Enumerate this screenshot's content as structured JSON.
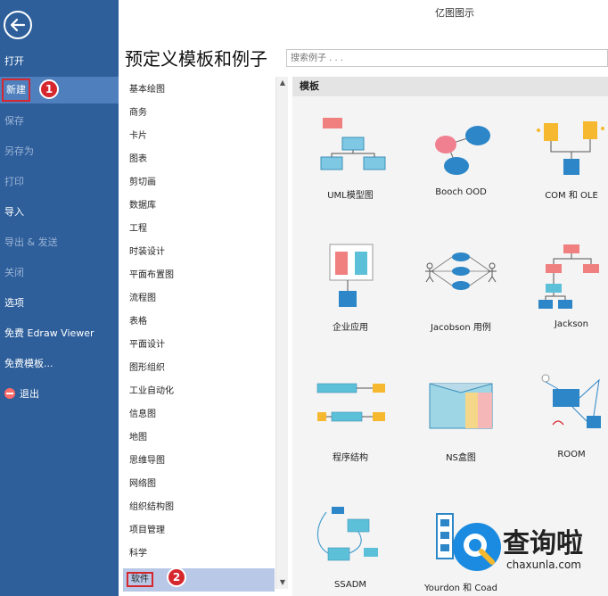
{
  "app_title": "亿图图示",
  "page_title": "预定义模板和例子",
  "search": {
    "placeholder": "搜索例子 . . ."
  },
  "sidebar": {
    "items": [
      {
        "label": "打开"
      },
      {
        "label": "新建"
      },
      {
        "label": "保存"
      },
      {
        "label": "另存为"
      },
      {
        "label": "打印"
      },
      {
        "label": "导入"
      },
      {
        "label": "导出 & 发送"
      },
      {
        "label": "关闭"
      },
      {
        "label": "选项"
      },
      {
        "label": "免费 Edraw Viewer"
      },
      {
        "label": "免费模板..."
      },
      {
        "label": "退出"
      }
    ]
  },
  "badges": {
    "one": "1",
    "two": "2"
  },
  "categories": [
    "基本绘图",
    "商务",
    "卡片",
    "图表",
    "剪切画",
    "数据库",
    "工程",
    "时装设计",
    "平面布置图",
    "流程图",
    "表格",
    "平面设计",
    "图形组织",
    "工业自动化",
    "信息图",
    "地图",
    "思维导图",
    "网络图",
    "组织结构图",
    "项目管理",
    "科学",
    "软件"
  ],
  "panel": {
    "header": "模板",
    "templates": [
      {
        "label": "UML模型图"
      },
      {
        "label": "Booch OOD"
      },
      {
        "label": "COM 和 OLE"
      },
      {
        "label": "企业应用"
      },
      {
        "label": "Jacobson 用例"
      },
      {
        "label": "Jackson"
      },
      {
        "label": "程序结构"
      },
      {
        "label": "NS盒图"
      },
      {
        "label": "ROOM"
      },
      {
        "label": "SSADM"
      },
      {
        "label": "Yourdon 和 Coad"
      }
    ]
  },
  "watermark": {
    "brand": "查询啦",
    "domain": "chaxunla.com"
  },
  "colors": {
    "sidebar": "#2e5f9b",
    "sidebar_active": "#4f7fbd",
    "highlight_red": "#d6262e",
    "selected_row": "#b9c8e6"
  }
}
